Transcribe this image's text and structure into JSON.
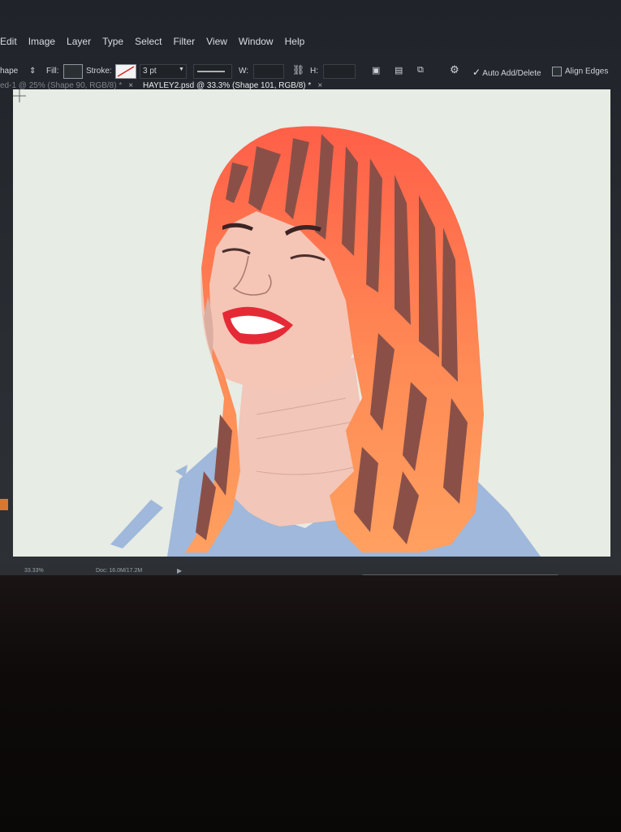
{
  "menu": {
    "items": [
      "Edit",
      "Image",
      "Layer",
      "Type",
      "Select",
      "Filter",
      "View",
      "Window",
      "Help"
    ]
  },
  "options": {
    "tool_mode": "hape",
    "fill_label": "Fill:",
    "stroke_label": "Stroke:",
    "stroke_width": "3 pt",
    "w_label": "W:",
    "h_label": "H:",
    "auto_add_delete": "Auto Add/Delete",
    "align_edges": "Align Edges"
  },
  "tabs": [
    {
      "label": "ed-1 @ 25% (Shape 90, RGB/8) *",
      "active": false
    },
    {
      "label": "HAYLEY2.psd @ 33.3% (Shape 101, RGB/8) *",
      "active": true
    }
  ],
  "status": {
    "zoom": "33.33%",
    "doc": "Doc: 16.0M/17.2M"
  },
  "colors": {
    "canvas_bg": "#e7ece4",
    "hair_light": "#ff9a5c",
    "hair_top": "#ff6a4a",
    "hair_dark": "#8a5048",
    "skin": "#f4c3b4",
    "lips": "#e52a35",
    "shirt": "#9fb8db"
  }
}
